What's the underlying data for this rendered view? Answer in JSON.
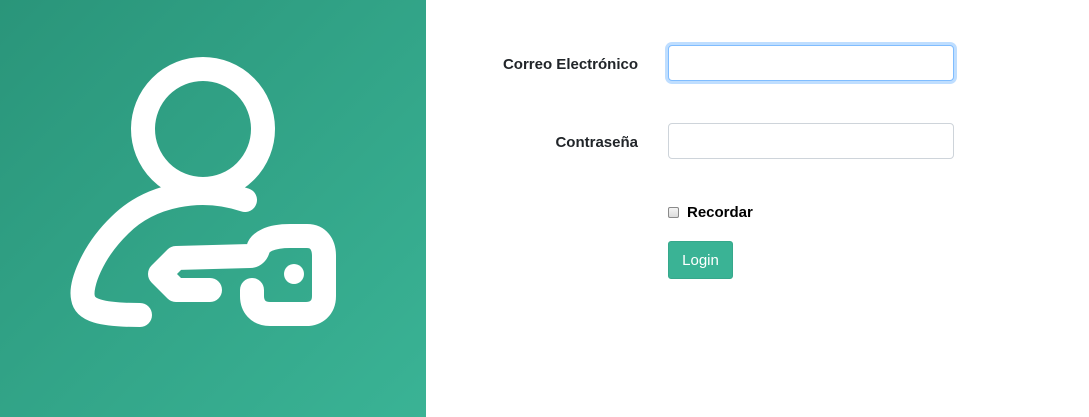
{
  "hero": {
    "icon": "user-key-icon",
    "background_from": "#2a957a",
    "background_to": "#3ab395"
  },
  "form": {
    "email_label": "Correo Electrónico",
    "email_value": "",
    "password_label": "Contraseña",
    "password_value": "",
    "remember_label": "Recordar",
    "remember_checked": false,
    "login_label": "Login",
    "accent_color": "#3ab395"
  }
}
